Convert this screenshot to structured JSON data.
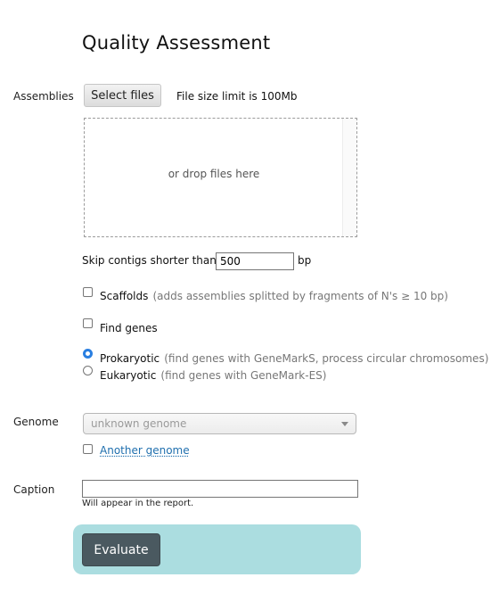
{
  "page": {
    "title": "Quality Assessment"
  },
  "assemblies": {
    "label": "Assemblies",
    "select_button": "Select files",
    "size_limit": "File size limit is 100Mb",
    "drop_text": "or drop files here"
  },
  "contigs": {
    "label": "Skip contigs shorter than",
    "value": "500",
    "unit": "bp"
  },
  "options": {
    "scaffolds": {
      "label": "Scaffolds",
      "hint": "(adds assemblies splitted by fragments of N's ≥ 10 bp)",
      "checked": false
    },
    "find_genes": {
      "label": "Find genes",
      "checked": false
    },
    "prokaryotic": {
      "label": "Prokaryotic",
      "hint": "(find genes with GeneMarkS, process circular chromosomes)",
      "selected": true
    },
    "eukaryotic": {
      "label": "Eukaryotic",
      "hint": "(find genes with GeneMark-ES)",
      "selected": false
    }
  },
  "genome": {
    "label": "Genome",
    "selected": "unknown genome",
    "another_label": "Another genome",
    "another_checked": false
  },
  "caption": {
    "label": "Caption",
    "value": "",
    "hint": "Will appear in the report."
  },
  "actions": {
    "evaluate_label": "Evaluate"
  },
  "colors": {
    "panel_bg": "#abdde0",
    "button_bg": "#4a5960",
    "link": "#1f6fae",
    "radio_accent": "#2a7fe1"
  },
  "icons": {
    "dropdown": "chevron-down-icon"
  }
}
